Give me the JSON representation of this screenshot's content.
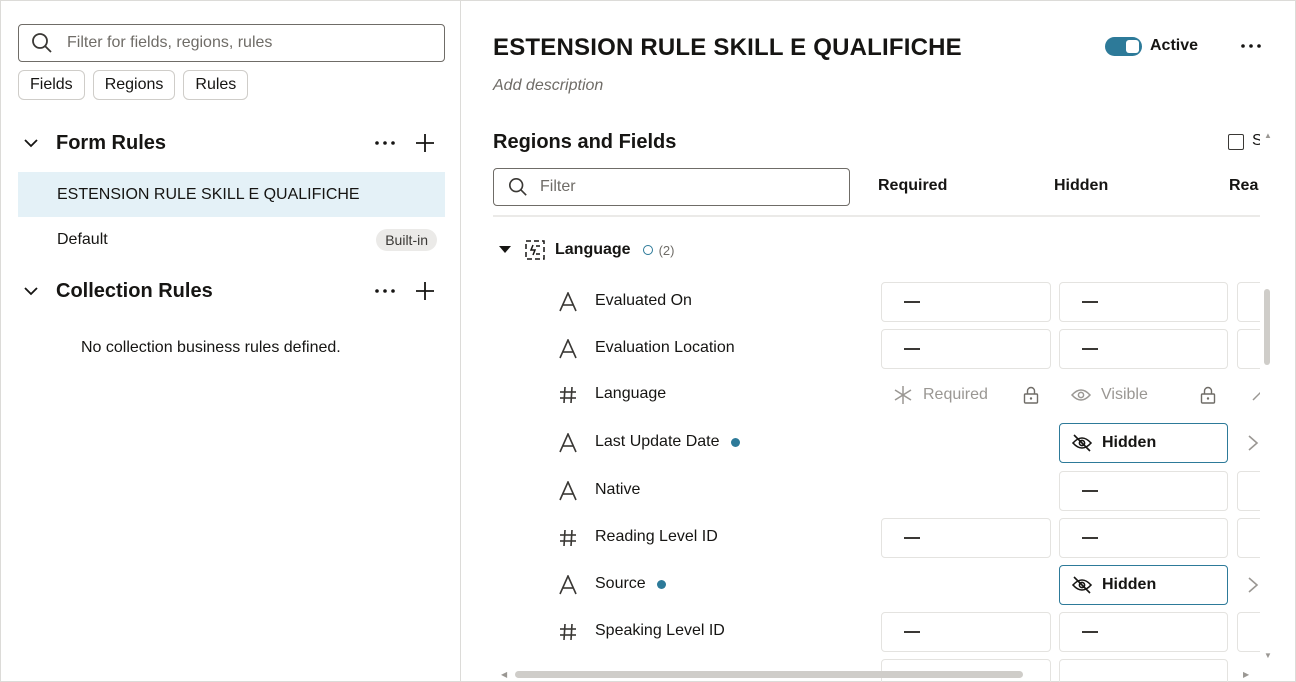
{
  "left": {
    "search_placeholder": "Filter for fields, regions, rules",
    "chips": [
      "Fields",
      "Regions",
      "Rules"
    ],
    "form_rules": {
      "title": "Form Rules",
      "items": [
        {
          "label": "ESTENSION RULE SKILL E QUALIFICHE",
          "badge": ""
        },
        {
          "label": "Default",
          "badge": "Built-in"
        }
      ]
    },
    "collection_rules": {
      "title": "Collection Rules",
      "empty_text": "No collection business rules defined."
    }
  },
  "main": {
    "title": "ESTENSION RULE SKILL E QUALIFICHE",
    "description_placeholder": "Add description",
    "active_label": "Active",
    "active": true,
    "section_title": "Regions and Fields",
    "checkbox_label": "S",
    "filter_placeholder": "Filter",
    "columns": [
      "Required",
      "Hidden",
      "Rea"
    ],
    "region": {
      "name": "Language",
      "count": "(2)"
    },
    "fields": [
      {
        "icon": "text-icon",
        "label": "Evaluated On",
        "modified": false,
        "required": "—",
        "hidden": "—",
        "read": "-"
      },
      {
        "icon": "text-icon",
        "label": "Evaluation Location",
        "modified": false,
        "required": "—",
        "hidden": "—",
        "read": "-"
      },
      {
        "icon": "number-icon",
        "label": "Language",
        "modified": false,
        "required": "Required",
        "hidden": "Visible",
        "read": ""
      },
      {
        "icon": "text-icon",
        "label": "Last Update Date",
        "modified": true,
        "required": "",
        "hidden": "Hidden",
        "read": ""
      },
      {
        "icon": "text-icon",
        "label": "Native",
        "modified": false,
        "required": "",
        "hidden": "—",
        "read": "-"
      },
      {
        "icon": "number-icon",
        "label": "Reading Level ID",
        "modified": false,
        "required": "—",
        "hidden": "—",
        "read": "-"
      },
      {
        "icon": "text-icon",
        "label": "Source",
        "modified": true,
        "required": "",
        "hidden": "Hidden",
        "read": ""
      },
      {
        "icon": "number-icon",
        "label": "Speaking Level ID",
        "modified": false,
        "required": "—",
        "hidden": "—",
        "read": "-"
      }
    ]
  },
  "colors": {
    "accent": "#2d7a99",
    "selected_bg": "#e4f1f7"
  }
}
